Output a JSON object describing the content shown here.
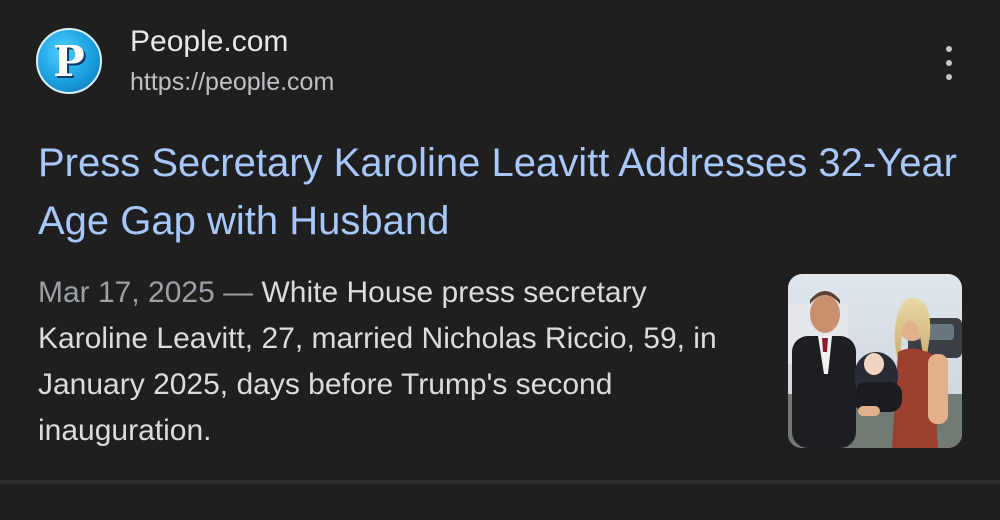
{
  "source": {
    "favicon_letter": "P",
    "name": "People.com",
    "url": "https://people.com",
    "favicon_color": "#1a9fe0"
  },
  "more_options_icon": "vertical-dots-icon",
  "headline": "Press Secretary Karoline Leavitt Addresses 32-Year Age Gap with Husband",
  "snippet": {
    "date": "Mar 17, 2025",
    "separator": " — ",
    "text": "White House press secretary Karoline Leavitt, 27, married Nicholas Riccio, 59, in January 2025, days before Trump's second inauguration."
  },
  "colors": {
    "background": "#1f1f1f",
    "headline_link": "#a8c7fa",
    "body_text": "#dadce0",
    "muted_text": "#9aa0a6"
  }
}
